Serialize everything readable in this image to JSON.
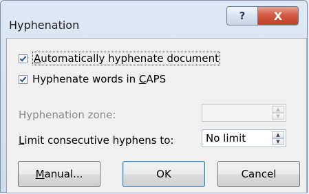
{
  "window": {
    "title": "Hyphenation",
    "help_label": "?",
    "close_label": "X"
  },
  "options": {
    "auto_hyphenate": {
      "label_mnemonic": "A",
      "label_rest": "utomatically hyphenate document",
      "checked": true
    },
    "hyphenate_caps": {
      "label_pre": "Hyphenate words in ",
      "label_mnemonic": "C",
      "label_rest": "APS",
      "checked": true
    }
  },
  "fields": {
    "zone": {
      "label": "Hyphenation zone:",
      "value": "",
      "disabled": true
    },
    "limit": {
      "label_mnemonic": "L",
      "label_rest": "imit consecutive hyphens to:",
      "value": "No limit"
    }
  },
  "buttons": {
    "manual_mnemonic": "M",
    "manual_rest": "anual...",
    "ok": "OK",
    "cancel": "Cancel"
  }
}
